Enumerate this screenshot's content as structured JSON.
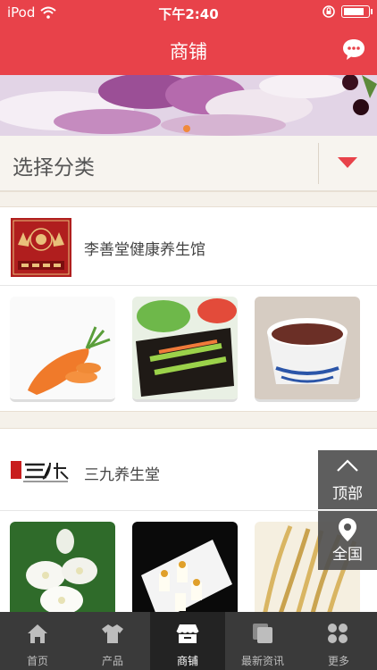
{
  "status_bar": {
    "carrier": "iPod",
    "time": "下午2:40",
    "battery_level": 0.85
  },
  "nav": {
    "title": "商铺",
    "message_icon": "chat-bubble-icon"
  },
  "category": {
    "label": "选择分类"
  },
  "shops": [
    {
      "name": "李善堂健康养生馆",
      "products": [
        "carrot",
        "seaweed-rolls",
        "red-bean-soup"
      ]
    },
    {
      "name": "三九养生堂",
      "products": [
        "jasmine-flowers",
        "plated-rolls",
        "dried-roots"
      ]
    }
  ],
  "float_buttons": {
    "top_label": "顶部",
    "nationwide_label": "全国"
  },
  "tabs": [
    {
      "label": "首页",
      "icon": "home-icon"
    },
    {
      "label": "产品",
      "icon": "shirt-icon"
    },
    {
      "label": "商铺",
      "icon": "store-icon",
      "active": true
    },
    {
      "label": "最新资讯",
      "icon": "news-icon"
    },
    {
      "label": "更多",
      "icon": "grid-icon"
    }
  ],
  "colors": {
    "brand": "#e8424a"
  }
}
